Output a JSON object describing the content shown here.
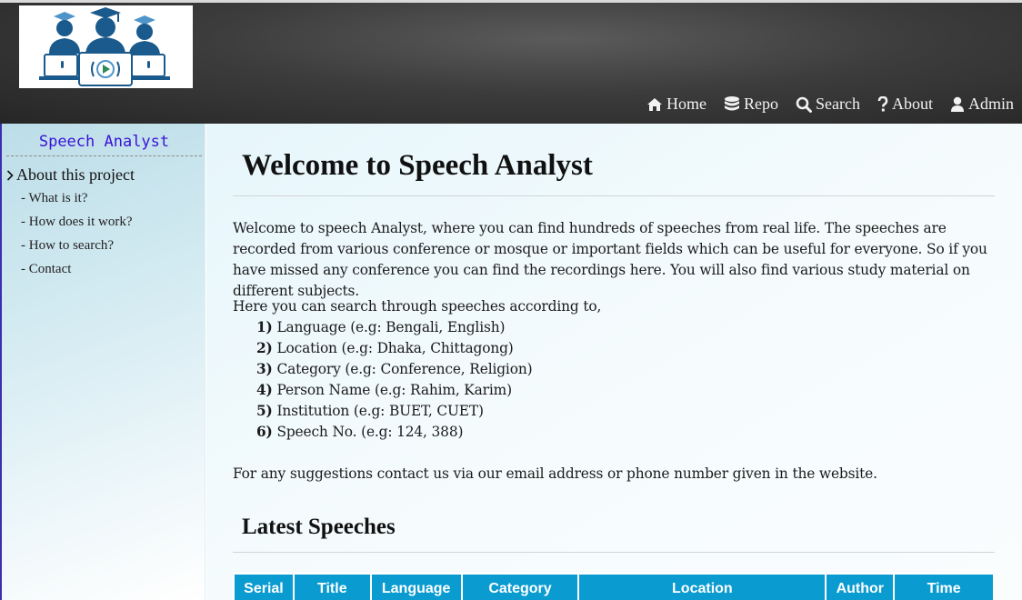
{
  "header": {
    "logo_name": "students-speech-logo",
    "nav": [
      {
        "label": "Home",
        "icon": "home-icon"
      },
      {
        "label": "Repo",
        "icon": "database-icon"
      },
      {
        "label": "Search",
        "icon": "search-icon"
      },
      {
        "label": "About",
        "icon": "question-icon"
      },
      {
        "label": "Admin",
        "icon": "user-icon"
      }
    ]
  },
  "sidebar": {
    "title": "Speech Analyst",
    "section": "About this project",
    "items": [
      "- What is it?",
      "- How does it work?",
      "- How to search?",
      "- Contact"
    ]
  },
  "main": {
    "title": "Welcome to Speech Analyst",
    "intro": "Welcome to speech Analyst, where you can find hundreds of speeches from real life. The speeches are recorded from various conference or mosque or important fields which can be useful for everyone. So if you have missed any conference you can find the recordings here. You will also find various study material on different subjects.",
    "search_intro": "Here you can search through speeches according to,",
    "criteria": [
      {
        "num": "1)",
        "text": "Language (e.g: Bengali, English)"
      },
      {
        "num": "2)",
        "text": "Location (e.g: Dhaka, Chittagong)"
      },
      {
        "num": "3)",
        "text": "Category (e.g: Conference, Religion)"
      },
      {
        "num": "4)",
        "text": "Person Name (e.g: Rahim, Karim)"
      },
      {
        "num": "5)",
        "text": "Institution (e.g: BUET, CUET)"
      },
      {
        "num": "6)",
        "text": "Speech No. (e.g: 124, 388)"
      }
    ],
    "contact_note": "For any suggestions contact us via our email address or phone number given in the website.",
    "latest_title": "Latest Speeches",
    "table_headers": [
      "Serial",
      "Title",
      "Language",
      "Category",
      "Location",
      "Author",
      "Time"
    ]
  },
  "colors": {
    "sidebar_title": "#3a13d6",
    "table_header": "#0a9bd0",
    "logo_blue": "#1b5a8c"
  }
}
